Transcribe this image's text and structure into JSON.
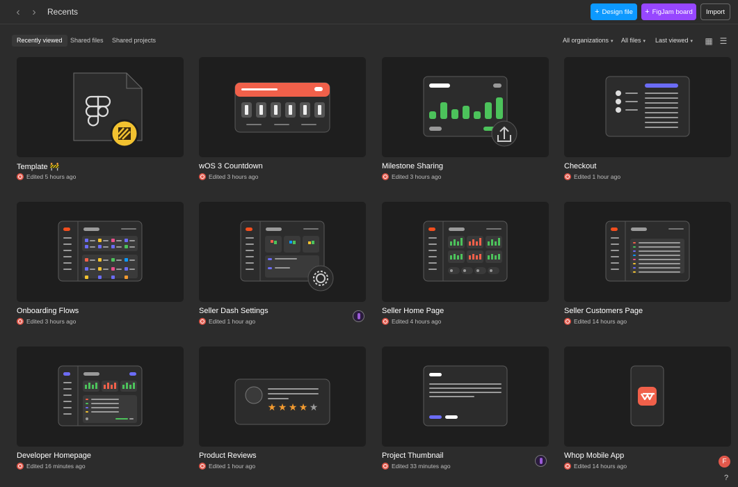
{
  "header": {
    "back_glyph": "‹",
    "forward_glyph": "›",
    "title": "Recents",
    "design_file_label": "Design file",
    "figjam_board_label": "FigJam board",
    "import_label": "Import",
    "plus_glyph": "+",
    "colors": {
      "design_file": "#0d99ff",
      "figjam_board": "#9747ff"
    }
  },
  "tabs": [
    {
      "label": "Recently viewed",
      "active": true
    },
    {
      "label": "Shared files",
      "active": false
    },
    {
      "label": "Shared projects",
      "active": false
    }
  ],
  "filters": {
    "organizations": "All organizations",
    "files": "All files",
    "sort": "Last viewed",
    "caret": "▾"
  },
  "view_toggle": {
    "grid_glyph": "▦",
    "list_glyph": "☰"
  },
  "files": [
    {
      "name": "Template 🚧",
      "edited": "Edited 5 hours ago",
      "thumb": "figma-file-icon"
    },
    {
      "name": "wOS 3 Countdown",
      "edited": "Edited 3 hours ago",
      "thumb": "countdown-card"
    },
    {
      "name": "Milestone Sharing",
      "edited": "Edited 3 hours ago",
      "thumb": "bar-chart-share"
    },
    {
      "name": "Checkout",
      "edited": "Edited 1 hour ago",
      "thumb": "checkout-list"
    },
    {
      "name": "Onboarding Flows",
      "edited": "Edited 3 hours ago",
      "thumb": "dashboard-grid"
    },
    {
      "name": "Seller Dash Settings",
      "edited": "Edited 1 hour ago",
      "thumb": "dashboard-settings"
    },
    {
      "name": "Seller Home Page",
      "edited": "Edited 4 hours ago",
      "thumb": "dashboard-charts"
    },
    {
      "name": "Seller Customers Page",
      "edited": "Edited 14 hours ago",
      "thumb": "dashboard-table"
    },
    {
      "name": "Developer Homepage",
      "edited": "Edited 16 minutes ago",
      "thumb": "developer-dashboard"
    },
    {
      "name": "Product Reviews",
      "edited": "Edited 1 hour ago",
      "thumb": "review-stars"
    },
    {
      "name": "Project Thumbnail",
      "edited": "Edited 33 minutes ago",
      "thumb": "text-thumbnail"
    },
    {
      "name": "Whop Mobile App",
      "edited": "Edited 14 hours ago",
      "thumb": "mobile-phone"
    }
  ],
  "current_user_initial": "F",
  "help_glyph": "?"
}
